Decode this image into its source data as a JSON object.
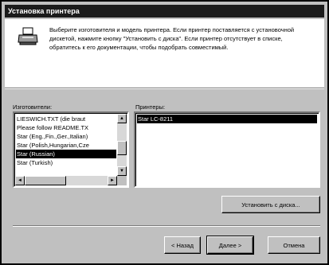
{
  "window": {
    "title": "Установка принтера"
  },
  "intro": {
    "text": "Выберите изготовителя и модель принтера. Если принтер поставляется с установочной дискетой, нажмите кнопку \"Установить с диска\". Если принтер отсутствует в списке, обратитесь к его документации, чтобы подобрать совместимый."
  },
  "manufacturers": {
    "label": "Изготовители:",
    "items": [
      {
        "label": "LIESWICH.TXT (die braut"
      },
      {
        "label": "Please follow README.TX"
      },
      {
        "label": "Star (Eng.,Fin.,Ger.,Italian)"
      },
      {
        "label": "Star (Polish,Hungarian,Cze"
      },
      {
        "label": "Star (Russian)"
      },
      {
        "label": "Star (Turkish)"
      }
    ],
    "selected": "Star (Russian)"
  },
  "printers": {
    "label": "Принтеры:",
    "items": [
      {
        "label": "Star LC-8211"
      }
    ],
    "selected": "Star LC-8211"
  },
  "buttons": {
    "have_disk": "Установить с диска...",
    "back": "< Назад",
    "next": "Далее >",
    "cancel": "Отмена"
  },
  "icons": {
    "printer": "printer-icon",
    "scroll_up": "▲",
    "scroll_down": "▼",
    "scroll_left": "◄",
    "scroll_right": "►"
  }
}
